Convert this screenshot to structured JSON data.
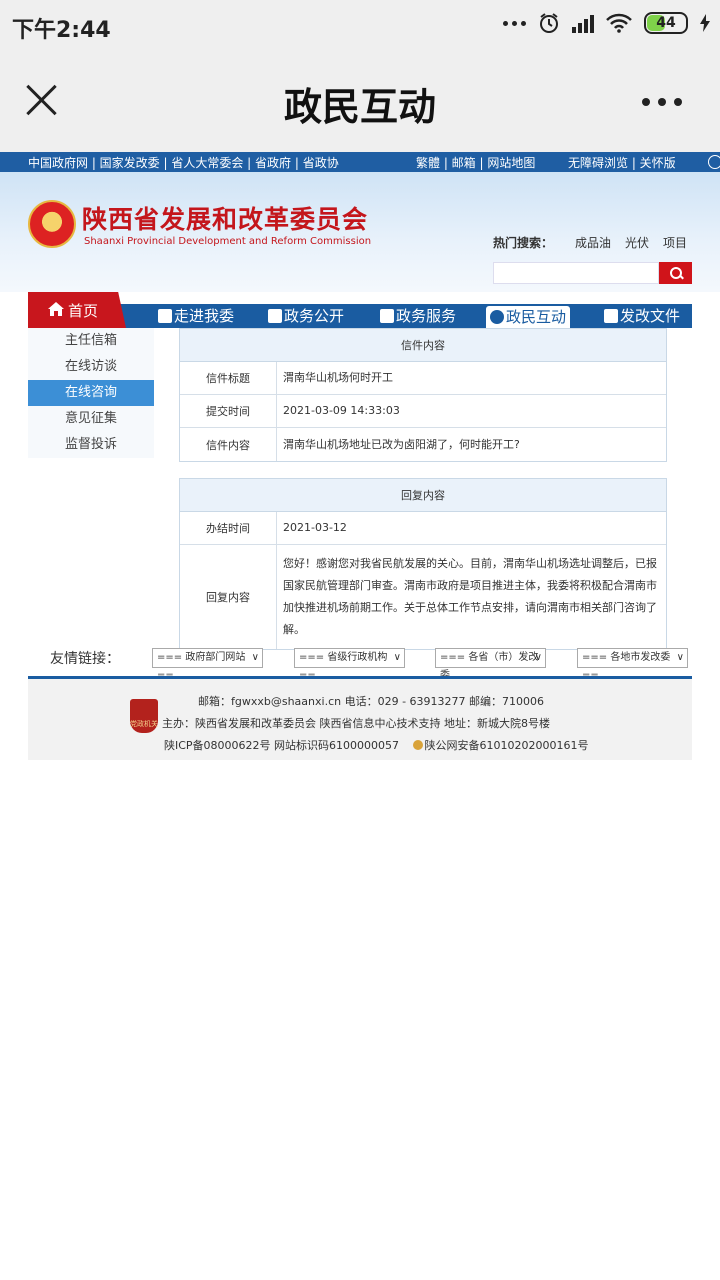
{
  "status_bar": {
    "time": "下午2:44",
    "battery": "44"
  },
  "app_header": {
    "title": "政民互动"
  },
  "site": {
    "top_links_left": "中国政府网 | 国家发改委 | 省人大常委会 | 省政府 | 省政协",
    "top_links_middle": "繁體 | 邮箱 | 网站地图",
    "top_links_right": "无障碍浏览 | 关怀版",
    "org_name_cn": "陕西省发展和改革委员会",
    "org_name_en": "Shaanxi Provincial Development and Reform Commission",
    "hot_search_label": "热门搜索：",
    "hot_search_terms": [
      "成品油",
      "光伏",
      "项目"
    ],
    "search_placeholder": "",
    "nav": {
      "home": "首页",
      "items": [
        "走进我委",
        "政务公开",
        "政务服务",
        "政民互动",
        "发改文件"
      ]
    },
    "sidebar": [
      "主任信箱",
      "在线访谈",
      "在线咨询",
      "意见征集",
      "监督投诉"
    ],
    "sidebar_active": "在线咨询",
    "letter": {
      "header": "信件内容",
      "rows": [
        {
          "label": "信件标题",
          "value": "渭南华山机场何时开工"
        },
        {
          "label": "提交时间",
          "value": "2021-03-09 14:33:03"
        },
        {
          "label": "信件内容",
          "value": "渭南华山机场地址已改为卤阳湖了，何时能开工?"
        }
      ]
    },
    "reply": {
      "header": "回复内容",
      "rows": [
        {
          "label": "办结时间",
          "value": "2021-03-12"
        },
        {
          "label": "回复内容",
          "value": "您好！感谢您对我省民航发展的关心。目前，渭南华山机场选址调整后，已报国家民航管理部门审查。渭南市政府是项目推进主体，我委将积极配合渭南市加快推进机场前期工作。关于总体工作节点安排，请向渭南市相关部门咨询了解。"
        }
      ]
    },
    "friend_links": {
      "label": "友情链接：",
      "selects": [
        "=== 政府部门网站 ==",
        "=== 省级行政机构 ==",
        "=== 各省（市）发改委",
        "=== 各地市发改委 =="
      ]
    },
    "footer": {
      "badge_text": "党政机关",
      "line1": "邮箱：fgwxxb@shaanxi.cn     电话：029 - 63913277     邮编：710006",
      "line2": "主办：陕西省发展和改革委员会     陕西省信息中心技术支持     地址：新城大院8号楼",
      "line3_icp": "陕ICP备08000622号  网站标识码6100000057",
      "line3_police": "陕公网安备61010202000161号"
    }
  },
  "colors": {
    "brand_red": "#c4161c",
    "nav_blue": "#1a5ca1",
    "sidebar_active": "#3c8fd6"
  }
}
